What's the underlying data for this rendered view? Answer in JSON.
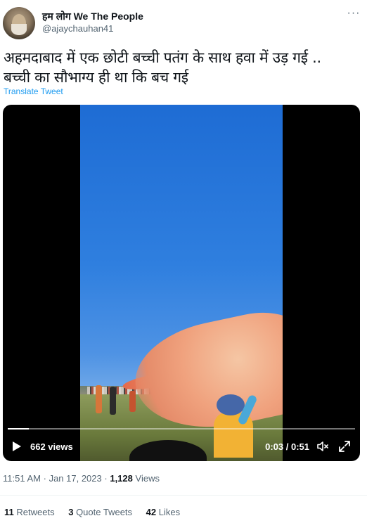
{
  "author": {
    "display_name": "हम लोग We The People",
    "handle": "@ajaychauhan41"
  },
  "tweet": {
    "text_line1": "अहमदाबाद में एक छोटी बच्ची पतंग के साथ हवा में उड़ गई ..",
    "text_line2": "बच्ची का सौभाग्य ही था कि बच गई",
    "translate_label": "Translate Tweet"
  },
  "video": {
    "views": "662 views",
    "time": "0:03 / 0:51",
    "progress": 0.06
  },
  "meta": {
    "time": "11:51 AM",
    "date": "Jan 17, 2023",
    "sep": "·",
    "views_count": "1,128",
    "views_label": "Views"
  },
  "stats": {
    "retweets_count": "11",
    "retweets_label": "Retweets",
    "quotes_count": "3",
    "quotes_label": "Quote Tweets",
    "likes_count": "42",
    "likes_label": "Likes"
  },
  "icons": {
    "more": "more-icon",
    "play": "play-icon",
    "mute": "mute-icon",
    "expand": "fullscreen-icon"
  },
  "colors": {
    "link": "#1d9bf0",
    "secondary_text": "#536471",
    "primary_text": "#0f1419"
  }
}
